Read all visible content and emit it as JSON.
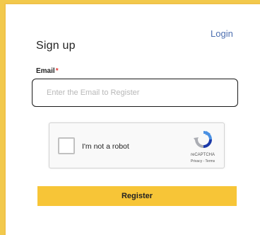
{
  "header": {
    "title": "Sign up",
    "login_link": "Login"
  },
  "form": {
    "email_label": "Email",
    "required_marker": "*",
    "email_placeholder": "Enter the Email to Register",
    "email_value": "",
    "register_label": "Register"
  },
  "recaptcha": {
    "checkbox_label": "I'm not a robot",
    "checked": false,
    "brand": "reCAPTCHA",
    "terms": "Privacy - Terms",
    "logo_icon": "recaptcha-logo-icon"
  },
  "colors": {
    "page_background": "#f2c94c",
    "button": "#f7c537",
    "link": "#4d6fb0",
    "required": "#e53935",
    "input_border": "#1a1a1a"
  }
}
